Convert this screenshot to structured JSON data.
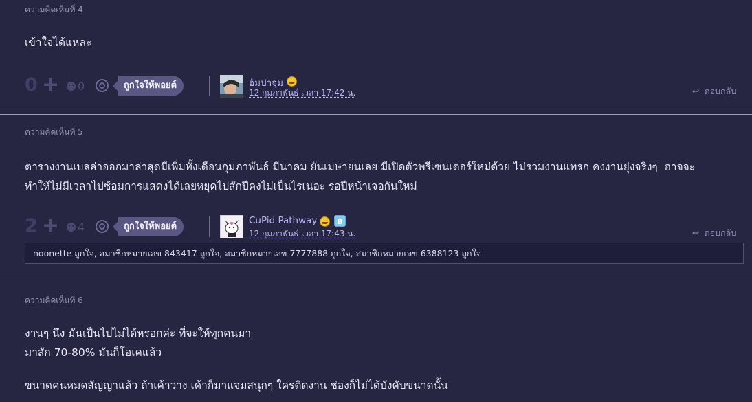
{
  "comments": [
    {
      "number_label": "ความคิดเห็นที่ 4",
      "text": "เข้าใจได้แหละ",
      "score": "0",
      "emotion_count": "0",
      "like_label": "ถูกใจให้พอยต์",
      "user": "อัมปาจุม",
      "date": "12 กุมภาพันธ์ เวลา 17:42 น.",
      "reply_label": "ตอบกลับ"
    },
    {
      "number_label": "ความคิดเห็นที่ 5",
      "text_lines": [
        "ตารางงานเบลล่าออกมาล่าสุดมีเพิ่มทั้งเดือนกุมภาพันธ์ มีนาคม ยันเมษายนเลย มีเปิดตัวพรีเซนเตอร์ใหม่ด้วย ไม่รวมงานแทรก คงงานยุ่งจริงๆ  อาจจะ",
        "ทำให้ไม่มีเวลาไปซ้อมการแสดงได้เลยหยุดไปสักปีคงไม่เป็นไรเนอะ รอปีหน้าเจอกันใหม่"
      ],
      "score": "2",
      "emotion_count": "4",
      "like_label": "ถูกใจให้พอยต์",
      "user": "CuPid Pathway",
      "badge": "B",
      "date": "12 กุมภาพันธ์ เวลา 17:43 น.",
      "reply_label": "ตอบกลับ",
      "likers": "noonette ถูกใจ, สมาชิกหมายเลข 843417 ถูกใจ, สมาชิกหมายเลข 7777888 ถูกใจ, สมาชิกหมายเลข 6388123 ถูกใจ"
    },
    {
      "number_label": "ความคิดเห็นที่ 6",
      "text_lines": [
        "งานๆ นึง มันเป็นไปไม่ได้หรอกค่ะ ที่จะให้ทุกคนมา",
        "มาสัก 70-80% มันก็โอเคแล้ว",
        "",
        "ขนาดคนหมดสัญญาแล้ว ถ้าเค้าว่าง เค้าก็มาแจมสนุกๆ ใครติดงาน ช่องก็ไม่ได้บังคับขนาดนั้น"
      ]
    }
  ],
  "colors": {
    "background": "#262643",
    "link": "#b7b3f0",
    "like_pill": "#5a5882"
  }
}
